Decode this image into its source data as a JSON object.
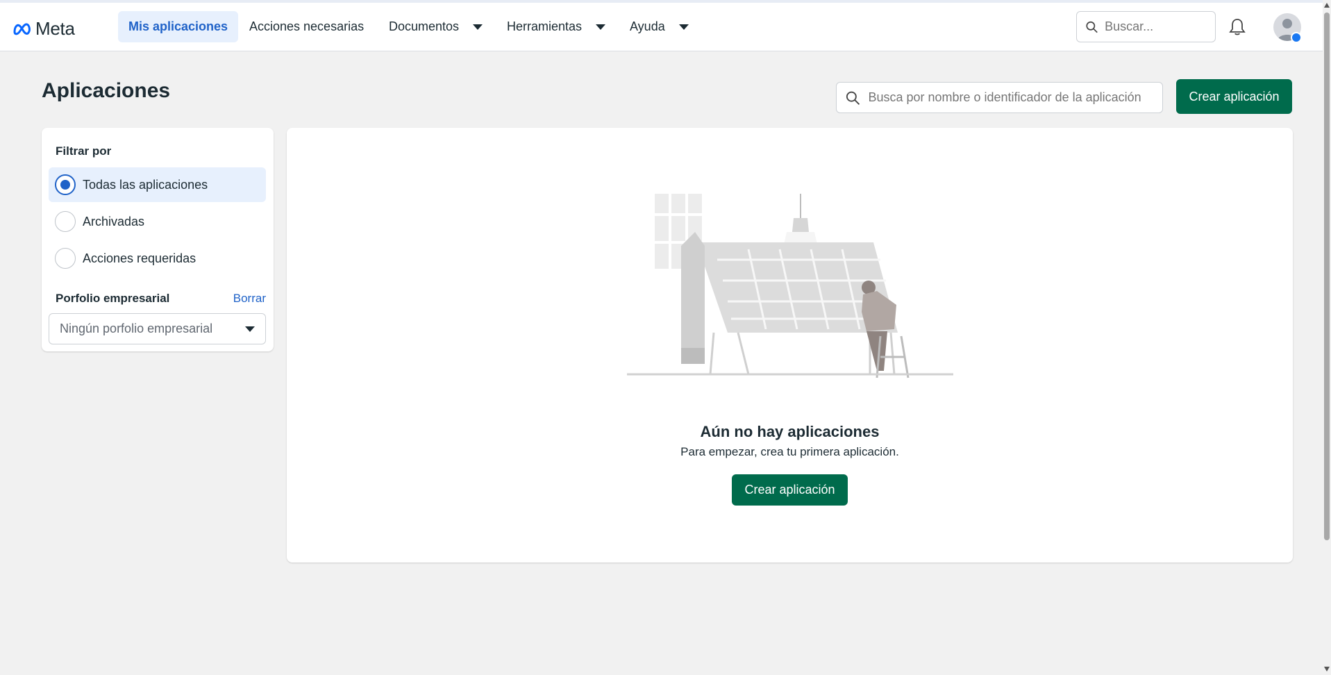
{
  "nav": {
    "brand": "Meta",
    "items": [
      {
        "label": "Mis aplicaciones",
        "active": true
      },
      {
        "label": "Acciones necesarias"
      },
      {
        "label": "Documentos",
        "dropdown": true
      },
      {
        "label": "Herramientas",
        "dropdown": true
      },
      {
        "label": "Ayuda",
        "dropdown": true
      }
    ],
    "search_placeholder": "Buscar..."
  },
  "page": {
    "title": "Aplicaciones",
    "search_placeholder": "Busca por nombre o identificador de la aplicación",
    "create_label": "Crear aplicación"
  },
  "filter": {
    "heading": "Filtrar por",
    "options": [
      {
        "label": "Todas las aplicaciones",
        "selected": true
      },
      {
        "label": "Archivadas",
        "selected": false
      },
      {
        "label": "Acciones requeridas",
        "selected": false
      }
    ],
    "portfolio_label": "Porfolio empresarial",
    "clear_label": "Borrar",
    "portfolio_value": "Ningún porfolio empresarial"
  },
  "empty_state": {
    "title": "Aún no hay aplicaciones",
    "subtitle": "Para empezar, crea tu primera aplicación.",
    "create_label": "Crear aplicación"
  },
  "colors": {
    "accent": "#1f62c8",
    "primary_button": "#006b4c",
    "background": "#f1f1f1"
  },
  "icons": [
    "meta-logo-icon",
    "chevron-down-icon",
    "search-icon",
    "bell-icon",
    "avatar-icon",
    "facebook-badge-icon",
    "empty-apps-illustration"
  ]
}
